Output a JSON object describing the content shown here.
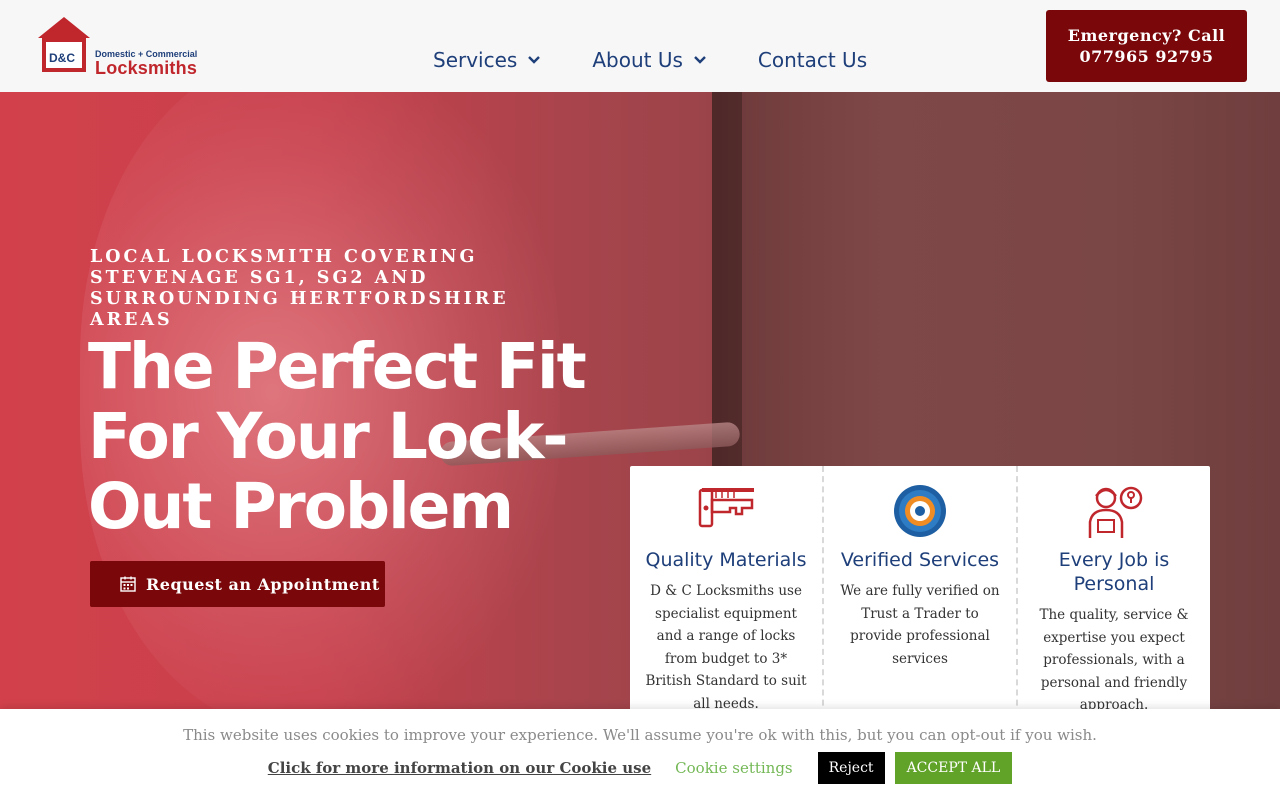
{
  "header": {
    "logo": {
      "initials": "D&C",
      "tagline": "Domestic + Commercial",
      "name": "Locksmiths"
    },
    "nav": [
      {
        "label": "Services",
        "has_dropdown": true
      },
      {
        "label": "About Us",
        "has_dropdown": true
      },
      {
        "label": "Contact Us",
        "has_dropdown": false
      }
    ],
    "emergency": {
      "line1": "Emergency? Call",
      "line2": "077965 92795"
    }
  },
  "hero": {
    "kicker": "LOCAL LOCKSMITH COVERING STEVENAGE SG1, SG2 AND SURROUNDING HERTFORDSHIRE AREAS",
    "headline": "The Perfect Fit For Your Lock-Out Problem",
    "cta_label": "Request an Appointment",
    "cta_icon": "calendar-icon"
  },
  "features": [
    {
      "icon": "key-icon",
      "title": "Quality Materials",
      "text": "D & C Locksmiths use specialist equipment and a range of locks from budget to 3* British Standard to suit all needs."
    },
    {
      "icon": "trust-a-trader-badge-icon",
      "title": "Verified Services",
      "text": "We are fully verified on Trust a Trader to provide professional services"
    },
    {
      "icon": "worker-icon",
      "title": "Every Job is Personal",
      "text": "The quality, service & expertise you expect professionals, with a personal and friendly approach."
    }
  ],
  "cookie_bar": {
    "message": "This website uses cookies to improve your experience. We'll assume you're ok with this, but you can opt-out if you wish.",
    "more_info": "Click for more information on our Cookie use",
    "settings": "Cookie settings",
    "reject": "Reject",
    "accept": "ACCEPT ALL"
  },
  "colors": {
    "brand_red": "#c0272d",
    "dark_red": "#7a0709",
    "navy": "#1e3f7a",
    "accept_green": "#61a229"
  }
}
